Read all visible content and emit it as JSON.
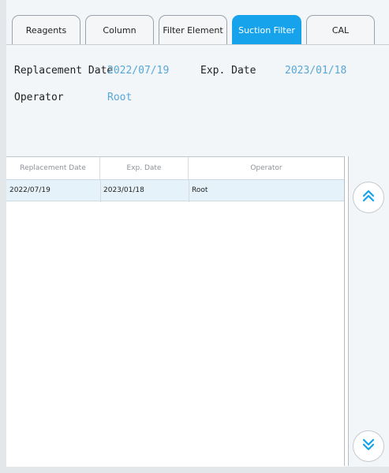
{
  "tabs": [
    {
      "label": "Reagents",
      "active": false
    },
    {
      "label": "Column",
      "active": false
    },
    {
      "label": "Filter Element",
      "active": false
    },
    {
      "label": "Suction Filter",
      "active": true
    },
    {
      "label": "CAL",
      "active": false
    }
  ],
  "info": {
    "replacement_date_label": "Replacement Date",
    "replacement_date_value": "2022/07/19",
    "exp_date_label": "Exp. Date",
    "exp_date_value": "2023/01/18",
    "operator_label": "Operator",
    "operator_value": "Root"
  },
  "table": {
    "headers": [
      "Replacement Date",
      "Exp. Date",
      "Operator"
    ],
    "rows": [
      {
        "replacement_date": "2022/07/19",
        "exp_date": "2023/01/18",
        "operator": "Root"
      }
    ]
  },
  "icons": {
    "scroll_up": "double-chevron-up-icon",
    "scroll_down": "double-chevron-down-icon"
  },
  "colors": {
    "accent": "#17a3ec",
    "value_text": "#56a7d8",
    "selected_row": "#e6f2fa"
  }
}
